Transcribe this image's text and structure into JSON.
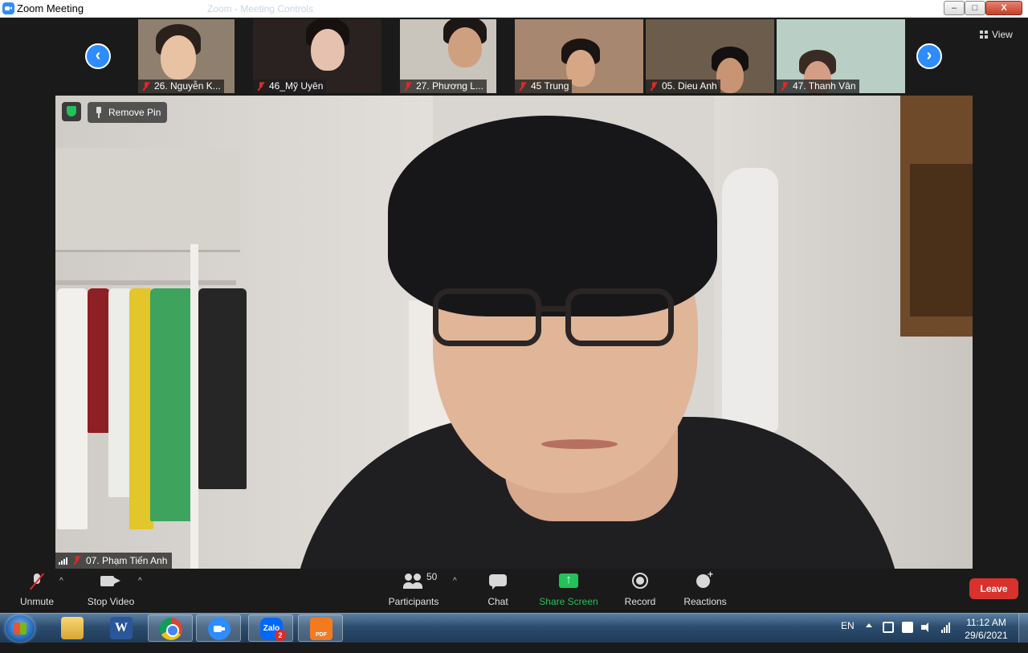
{
  "window": {
    "title": "Zoom Meeting",
    "ghost_title": "Zoom - Meeting Controls",
    "minimize_symbol": "–",
    "maximize_symbol": "□",
    "close_symbol": "X"
  },
  "strip": {
    "prev_symbol": "‹",
    "next_symbol": "›",
    "view_label": "View"
  },
  "participants": [
    {
      "label": "26. Nguyễn K...",
      "bg": "#8f7f6e",
      "face": "#e8c2a3",
      "hair": "#2b211c"
    },
    {
      "label": "46_Mỹ Uyên",
      "bg": "#2a2220",
      "face": "#e6c1b0",
      "hair": "#16110f"
    },
    {
      "label": "27. Phương L...",
      "bg": "#c9c5bd",
      "face": "#cfa07f",
      "hair": "#1c1614"
    },
    {
      "label": "45 Trung",
      "bg": "#a7876f",
      "face": "#d6a685",
      "hair": "#1a1412"
    },
    {
      "label": "05. Dieu Anh",
      "bg": "#6b5c4b",
      "face": "#c89473",
      "hair": "#141010"
    },
    {
      "label": "47. Thanh Vân",
      "bg": "#b9cfc6",
      "face": "#d49d85",
      "hair": "#3a2a25"
    }
  ],
  "main_video": {
    "remove_pin_label": "Remove Pin",
    "speaker_name": "07. Phạm Tiến Anh"
  },
  "toolbar": {
    "unmute_label": "Unmute",
    "stop_video_label": "Stop Video",
    "participants_label": "Participants",
    "participants_count": "50",
    "chat_label": "Chat",
    "share_screen_label": "Share Screen",
    "record_label": "Record",
    "reactions_label": "Reactions",
    "leave_label": "Leave",
    "caret_symbol": "^"
  },
  "taskbar": {
    "apps": [
      "file-explorer",
      "microsoft-word",
      "google-chrome",
      "zoom",
      "zalo",
      "pdf-reader"
    ],
    "word_letter": "W",
    "zalo_text": "Zalo",
    "zalo_badge": "2",
    "pdf_text": "PDF",
    "language": "EN",
    "time": "11:12 AM",
    "date": "29/6/2021"
  },
  "colors": {
    "zoom_blue": "#2d8cff",
    "share_green": "#23c15a",
    "leave_red": "#d9312b",
    "muted_red": "#e02828"
  }
}
